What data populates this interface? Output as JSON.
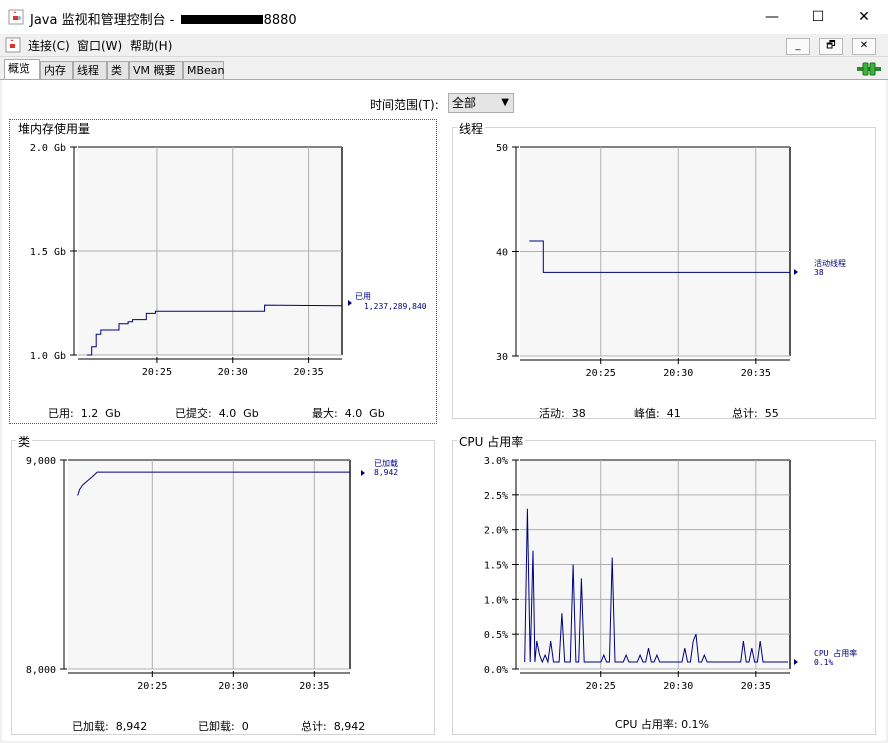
{
  "window": {
    "title_prefix": "Java 监视和管理控制台 - ",
    "title_suffix": "8880",
    "minimize_glyph": "—",
    "maximize_glyph": "☐",
    "close_glyph": "✕"
  },
  "menu": {
    "items": [
      "连接(C)",
      "窗口(W)",
      "帮助(H)"
    ],
    "mdi_minimize": "_",
    "mdi_restore": "🗗",
    "mdi_close": "✕"
  },
  "tabs": [
    "概览",
    "内存",
    "线程",
    "类",
    "VM 概要",
    "MBean"
  ],
  "time_range": {
    "label": "时间范围(T):",
    "value": "全部"
  },
  "panels": {
    "heap": {
      "title": "堆内存使用量",
      "summary": [
        "已用:  1.2  Gb",
        "已提交:  4.0  Gb",
        "最大:  4.0  Gb"
      ],
      "legend_name": "已用",
      "legend_value": "1,237,289,840"
    },
    "threads": {
      "title": "线程",
      "summary": [
        "活动:  38",
        "峰值:  41",
        "总计:  55"
      ],
      "legend_name": "活动线程",
      "legend_value": "38"
    },
    "classes": {
      "title": "类",
      "summary": [
        "已加载:  8,942",
        "已卸载:  0",
        "总计:  8,942"
      ],
      "legend_name": "已加载",
      "legend_value": "8,942"
    },
    "cpu": {
      "title": "CPU 占用率",
      "summary": [
        "CPU 占用率: 0.1%"
      ],
      "legend_name": "CPU 占用率",
      "legend_value": "0.1%"
    }
  },
  "colors": {
    "series": "#000080",
    "grid": "#b0b0b0",
    "plot_bg": "#f7f7f7"
  },
  "chart_data": [
    {
      "type": "line",
      "title": "堆内存使用量",
      "xticks": [
        "20:25",
        "20:30",
        "20:35"
      ],
      "yticks": [
        "1.0 Gb",
        "1.5 Gb",
        "2.0 Gb"
      ],
      "ylim": [
        1.0,
        2.0
      ],
      "xlim": [
        20.33,
        20.62
      ],
      "series": [
        {
          "name": "已用",
          "x": [
            20.34,
            20.345,
            20.345,
            20.35,
            20.35,
            20.355,
            20.355,
            20.375,
            20.375,
            20.385,
            20.385,
            20.39,
            20.39,
            20.405,
            20.405,
            20.415,
            20.415,
            20.465,
            20.465,
            20.535,
            20.535,
            20.62
          ],
          "y": [
            1.0,
            1.0,
            1.04,
            1.04,
            1.1,
            1.1,
            1.12,
            1.12,
            1.15,
            1.15,
            1.16,
            1.16,
            1.17,
            1.17,
            1.2,
            1.2,
            1.21,
            1.21,
            1.21,
            1.21,
            1.24,
            1.237
          ]
        }
      ]
    },
    {
      "type": "line",
      "title": "线程",
      "xticks": [
        "20:25",
        "20:30",
        "20:35"
      ],
      "yticks": [
        "30",
        "40",
        "50"
      ],
      "ylim": [
        30,
        50
      ],
      "xlim": [
        20.33,
        20.62
      ],
      "series": [
        {
          "name": "活动线程",
          "x": [
            20.34,
            20.355,
            20.355,
            20.62
          ],
          "y": [
            41,
            41,
            38,
            38
          ]
        }
      ]
    },
    {
      "type": "line",
      "title": "类",
      "xticks": [
        "20:25",
        "20:30",
        "20:35"
      ],
      "yticks": [
        "8,000",
        "9,000"
      ],
      "ylim": [
        8000,
        9000
      ],
      "xlim": [
        20.33,
        20.62
      ],
      "series": [
        {
          "name": "已加载",
          "x": [
            20.34,
            20.342,
            20.345,
            20.35,
            20.355,
            20.36,
            20.62
          ],
          "y": [
            8830,
            8860,
            8880,
            8900,
            8920,
            8942,
            8942
          ]
        }
      ]
    },
    {
      "type": "line",
      "title": "CPU 占用率",
      "xticks": [
        "20:25",
        "20:30",
        "20:35"
      ],
      "yticks": [
        "0.0%",
        "0.5%",
        "1.0%",
        "1.5%",
        "2.0%",
        "2.5%",
        "3.0%"
      ],
      "ylim": [
        0.0,
        3.0
      ],
      "xlim": [
        20.33,
        20.62
      ],
      "series": [
        {
          "name": "CPU 占用率",
          "x": [
            20.335,
            20.338,
            20.341,
            20.344,
            20.346,
            20.348,
            20.351,
            20.354,
            20.357,
            20.36,
            20.363,
            20.366,
            20.369,
            20.372,
            20.375,
            20.378,
            20.381,
            20.384,
            20.387,
            20.39,
            20.393,
            20.396,
            20.399,
            20.402,
            20.405,
            20.408,
            20.411,
            20.414,
            20.417,
            20.42,
            20.423,
            20.426,
            20.429,
            20.432,
            20.435,
            20.438,
            20.441,
            20.444,
            20.447,
            20.45,
            20.453,
            20.456,
            20.459,
            20.462,
            20.465,
            20.468,
            20.471,
            20.474,
            20.477,
            20.48,
            20.483,
            20.486,
            20.489,
            20.492,
            20.495,
            20.498,
            20.501,
            20.504,
            20.507,
            20.51,
            20.513,
            20.516,
            20.519,
            20.522,
            20.525,
            20.528,
            20.531,
            20.534,
            20.537,
            20.54,
            20.543,
            20.546,
            20.549,
            20.552,
            20.555,
            20.558,
            20.561,
            20.564,
            20.567,
            20.57,
            20.573,
            20.576,
            20.579,
            20.582,
            20.585,
            20.588,
            20.591,
            20.594,
            20.597,
            20.6,
            20.603,
            20.606,
            20.609,
            20.612,
            20.615,
            20.618
          ],
          "y": [
            0.1,
            2.3,
            0.1,
            1.7,
            0.1,
            0.4,
            0.2,
            0.1,
            0.2,
            0.1,
            0.4,
            0.1,
            0.1,
            0.1,
            0.8,
            0.1,
            0.1,
            0.1,
            1.5,
            0.1,
            0.1,
            1.3,
            0.1,
            0.1,
            0.1,
            0.1,
            0.1,
            0.1,
            0.1,
            0.2,
            0.1,
            0.1,
            1.6,
            0.1,
            0.1,
            0.1,
            0.1,
            0.2,
            0.1,
            0.1,
            0.1,
            0.1,
            0.2,
            0.1,
            0.1,
            0.3,
            0.1,
            0.1,
            0.2,
            0.1,
            0.1,
            0.1,
            0.1,
            0.1,
            0.1,
            0.1,
            0.1,
            0.1,
            0.3,
            0.1,
            0.1,
            0.4,
            0.5,
            0.1,
            0.1,
            0.2,
            0.1,
            0.1,
            0.1,
            0.1,
            0.1,
            0.1,
            0.1,
            0.1,
            0.1,
            0.1,
            0.1,
            0.1,
            0.1,
            0.4,
            0.1,
            0.1,
            0.3,
            0.1,
            0.1,
            0.4,
            0.1,
            0.1,
            0.1,
            0.1,
            0.1,
            0.1,
            0.1,
            0.1,
            0.1,
            0.1
          ]
        }
      ]
    }
  ]
}
